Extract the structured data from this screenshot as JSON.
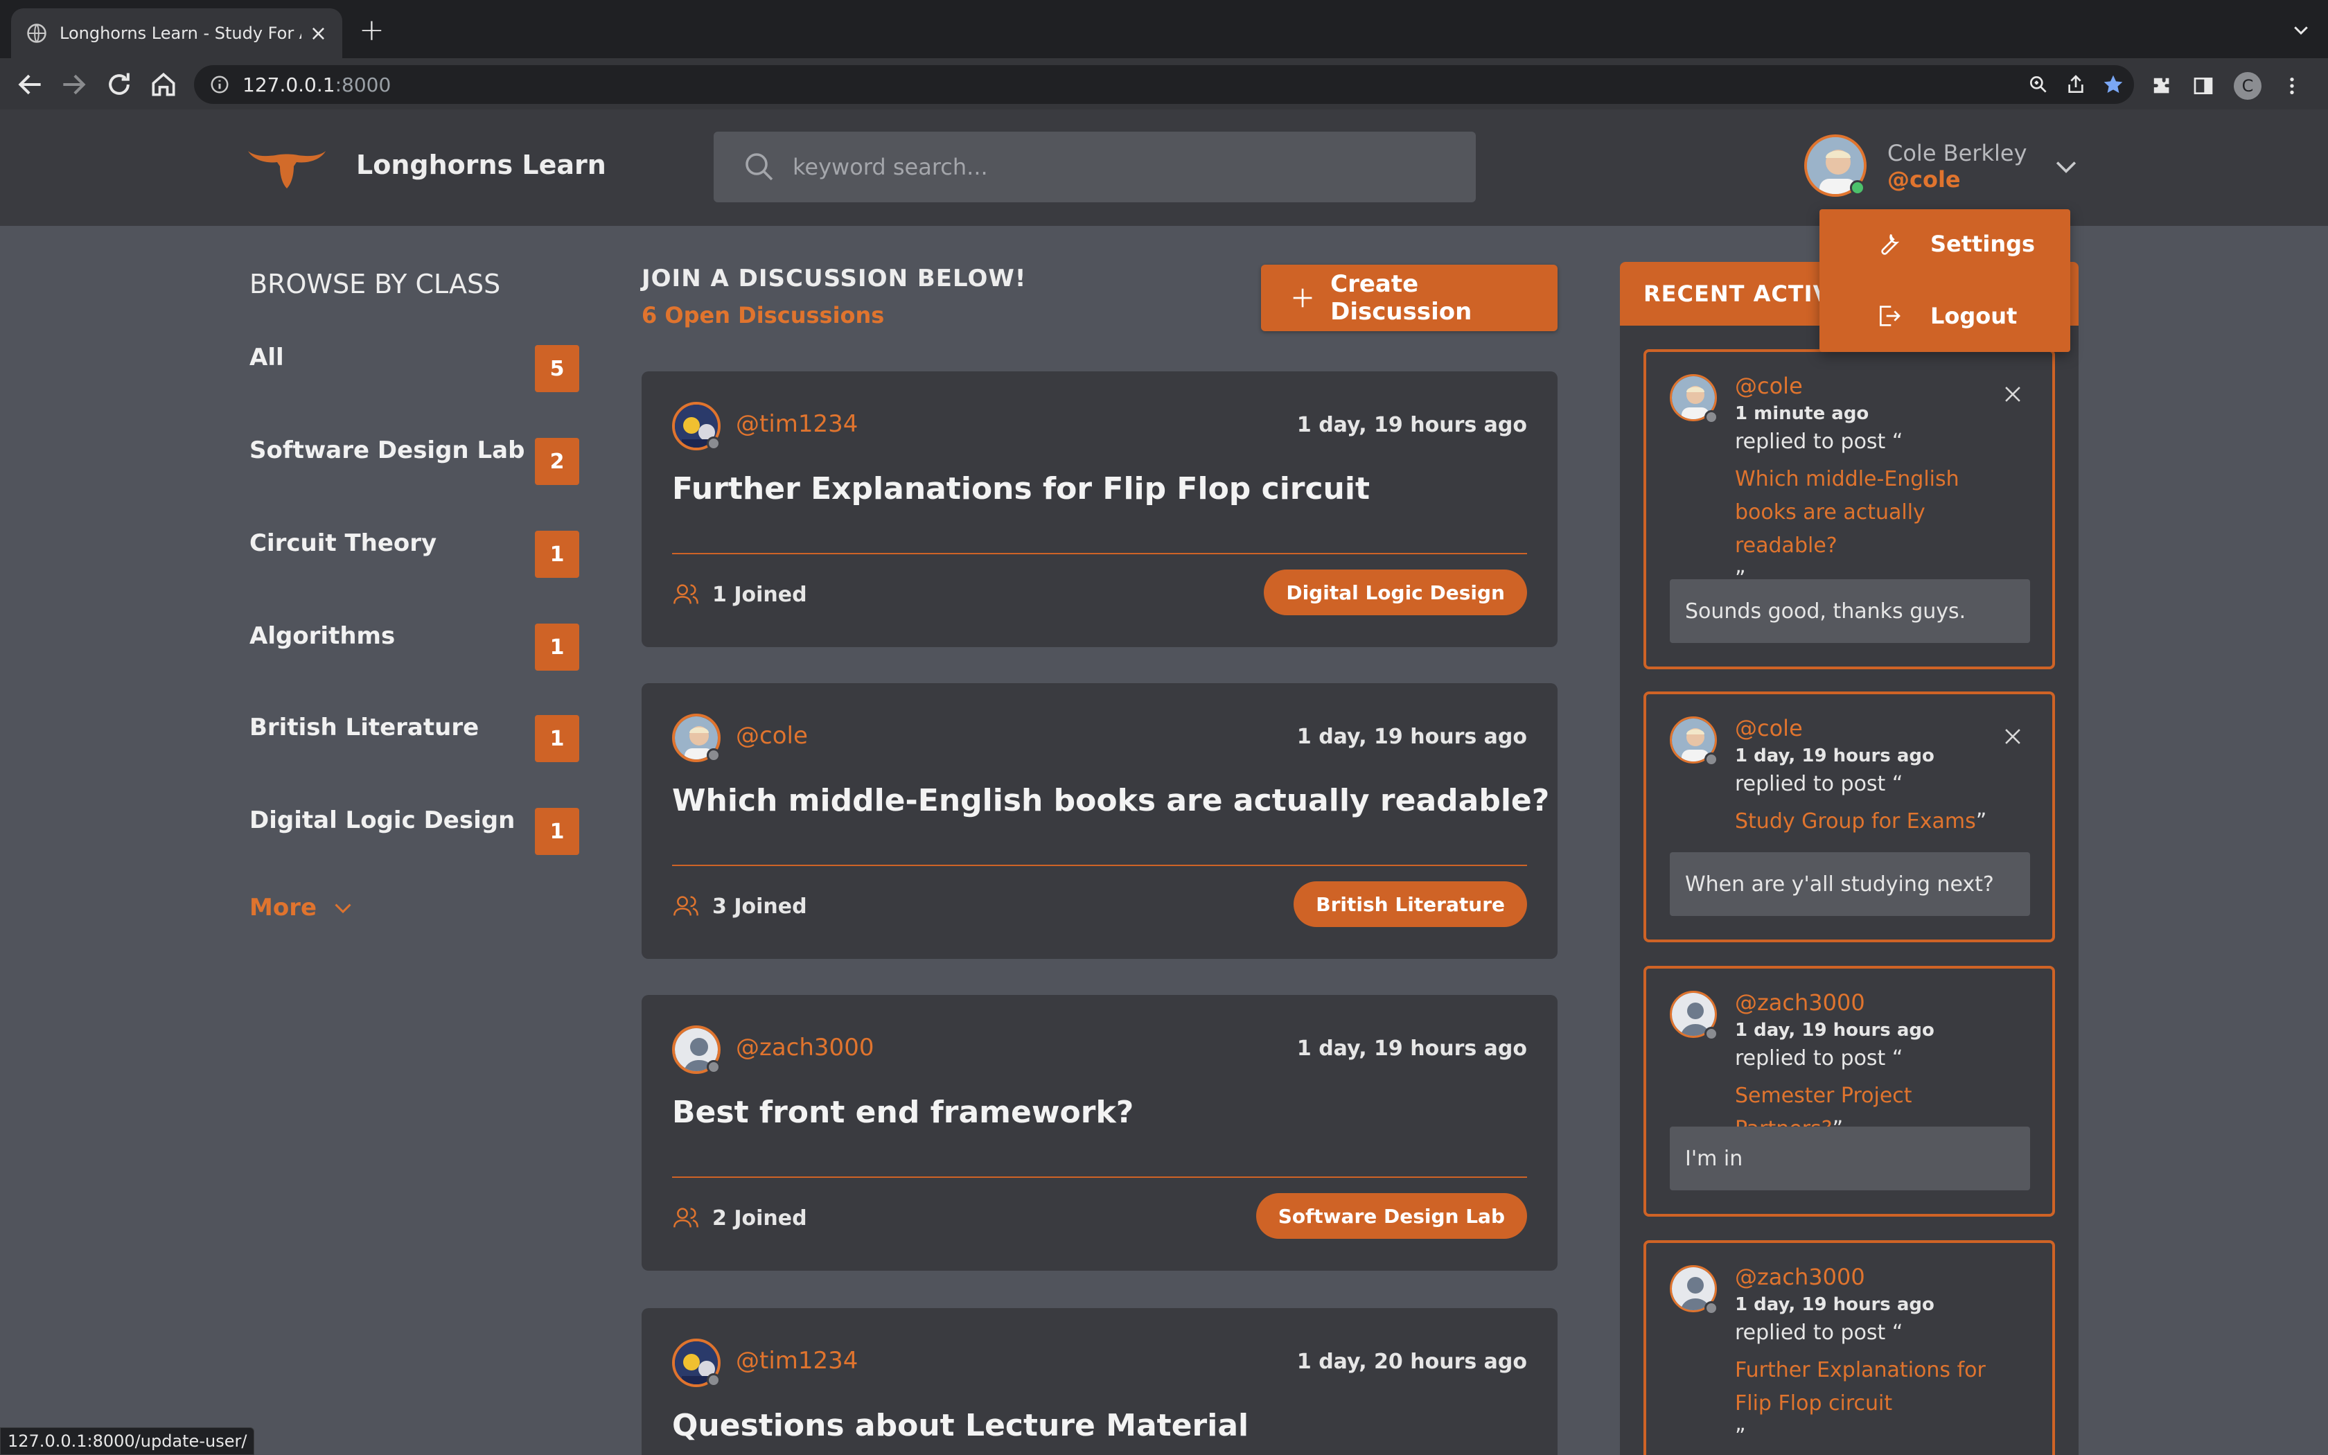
{
  "browser": {
    "tab_title": "Longhorns Learn - Study For A",
    "url_host": "127.0.0.1",
    "url_port": ":8000",
    "profile_initial": "C",
    "status_url": "127.0.0.1:8000/update-user/"
  },
  "header": {
    "brand": "Longhorns Learn",
    "search_placeholder": "keyword search...",
    "user_name": "Cole Berkley",
    "user_handle": "@cole"
  },
  "dropdown": {
    "settings": "Settings",
    "logout": "Logout"
  },
  "sidebar": {
    "title": "BROWSE BY CLASS",
    "classes": [
      {
        "name": "All",
        "count": "5"
      },
      {
        "name": "Software Design Lab",
        "count": "2"
      },
      {
        "name": "Circuit Theory",
        "count": "1"
      },
      {
        "name": "Algorithms",
        "count": "1"
      },
      {
        "name": "British Literature",
        "count": "1"
      },
      {
        "name": "Digital Logic Design",
        "count": "1"
      }
    ],
    "more": "More"
  },
  "feed": {
    "title": "JOIN A DISCUSSION BELOW!",
    "subtitle": "6 Open Discussions",
    "create_label": "Create Discussion",
    "posts": [
      {
        "handle": "@tim1234",
        "time": "1 day, 19 hours ago",
        "title": "Further Explanations for Flip Flop circuit",
        "joined": "1 Joined",
        "tag": "Digital Logic Design"
      },
      {
        "handle": "@cole",
        "time": "1 day, 19 hours ago",
        "title": "Which middle-English books are actually readable?",
        "joined": "3 Joined",
        "tag": "British Literature"
      },
      {
        "handle": "@zach3000",
        "time": "1 day, 19 hours ago",
        "title": "Best front end framework?",
        "joined": "2 Joined",
        "tag": "Software Design Lab"
      },
      {
        "handle": "@tim1234",
        "time": "1 day, 20 hours ago",
        "title": "Questions about Lecture Material",
        "joined": "",
        "tag": ""
      }
    ]
  },
  "activity": {
    "title": "RECENT ACTIVIT",
    "items": [
      {
        "handle": "@cole",
        "time": "1 minute ago",
        "replied": "replied to post “",
        "post": "Which middle-English books are actually readable?",
        "close_quote": "”",
        "message": "Sounds good, thanks guys."
      },
      {
        "handle": "@cole",
        "time": "1 day, 19 hours ago",
        "replied": "replied to post “",
        "post": "Study Group for Exams",
        "close_quote": "”",
        "message": "When are y'all studying next?"
      },
      {
        "handle": "@zach3000",
        "time": "1 day, 19 hours ago",
        "replied": "replied to post “",
        "post": "Semester Project Partners?",
        "close_quote": "”",
        "message": "I'm in"
      },
      {
        "handle": "@zach3000",
        "time": "1 day, 19 hours ago",
        "replied": "replied to post “",
        "post": "Further Explanations for Flip Flop circuit",
        "close_quote": "”",
        "message": ""
      }
    ]
  },
  "colors": {
    "accent": "#cf6326",
    "accent_text": "#e0742e",
    "panel": "#3a3b40",
    "background": "#51545c"
  }
}
